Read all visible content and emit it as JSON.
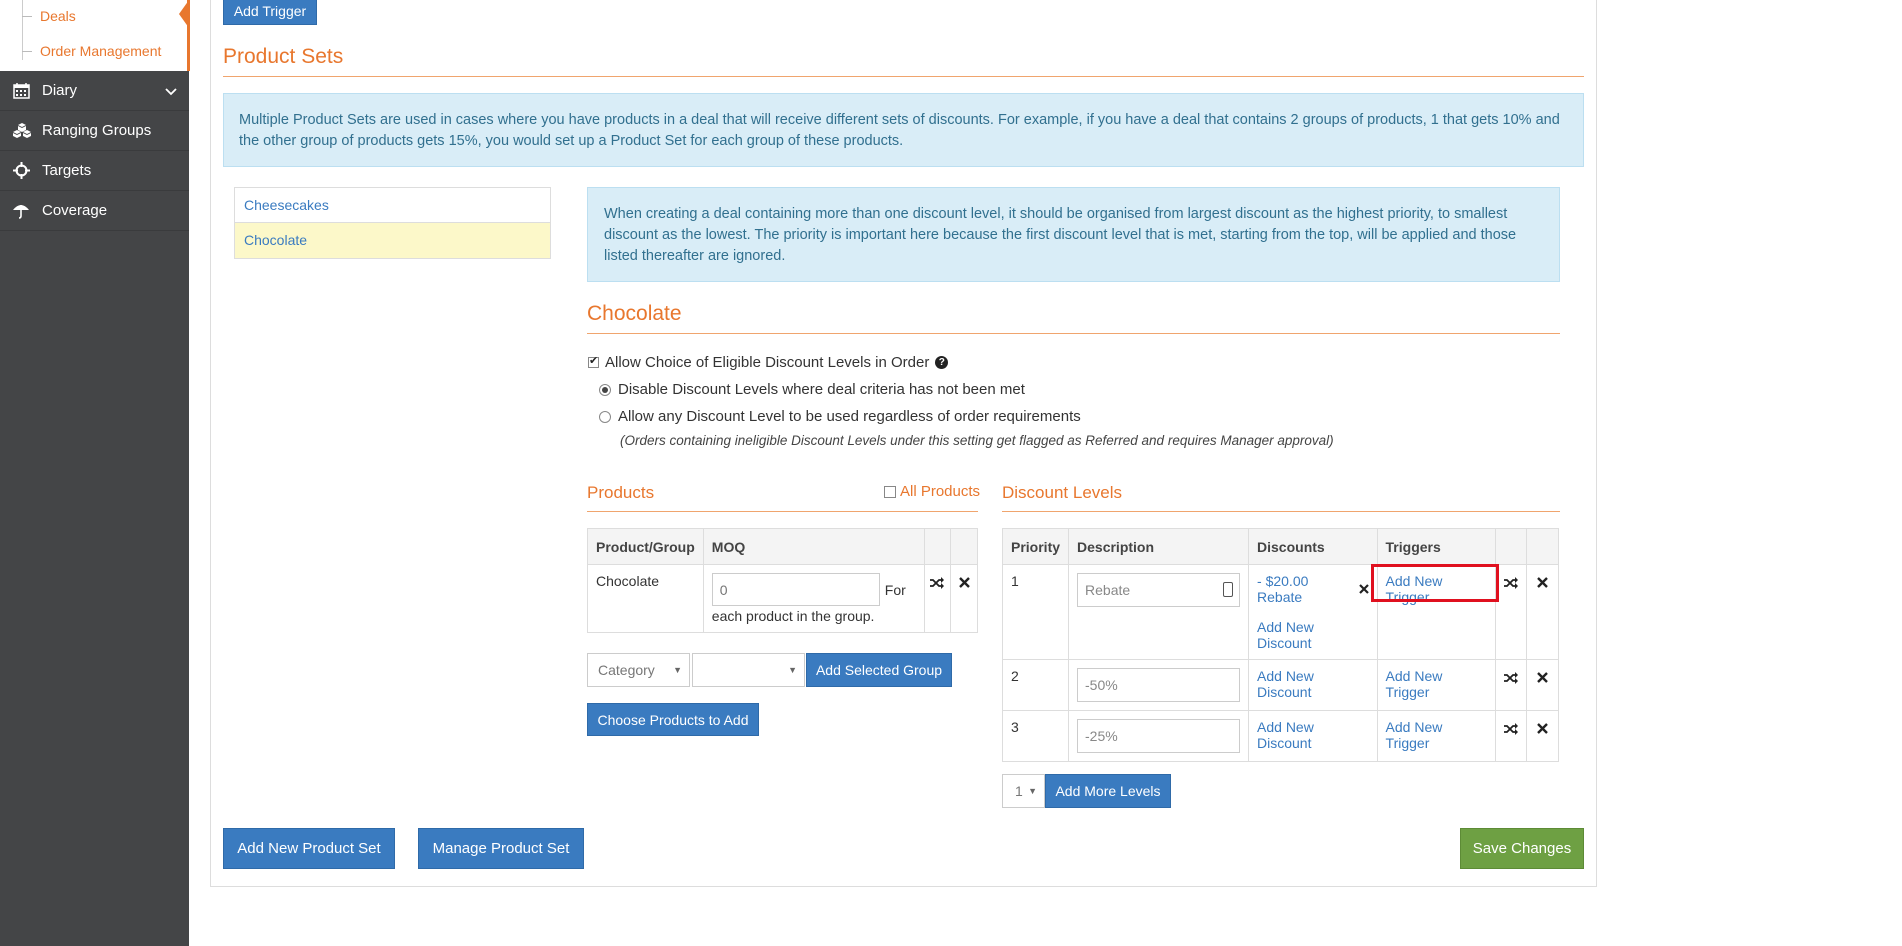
{
  "sidebar": {
    "sub_items": [
      {
        "label": "Deals"
      },
      {
        "label": "Order Management"
      }
    ],
    "nav": [
      {
        "label": "Diary",
        "icon": "calendar-icon",
        "has_chevron": true
      },
      {
        "label": "Ranging Groups",
        "icon": "cubes-icon"
      },
      {
        "label": "Targets",
        "icon": "crosshair-icon"
      },
      {
        "label": "Coverage",
        "icon": "umbrella-icon"
      }
    ]
  },
  "top": {
    "add_trigger_label": "Add Trigger"
  },
  "product_sets": {
    "title": "Product Sets",
    "info": "Multiple Product Sets are used in cases where you have products in a deal that will receive different sets of discounts. For example, if you have a deal that contains 2 groups of products, 1 that gets 10% and the other group of products gets 15%, you would set up a Product Set for each group of these products.",
    "list": [
      {
        "label": "Cheesecakes",
        "active": false
      },
      {
        "label": "Chocolate",
        "active": true
      }
    ]
  },
  "detail": {
    "info": "When creating a deal containing more than one discount level, it should be organised from largest discount as the highest priority, to smallest discount as the lowest. The priority is important here because the first discount level that is met, starting from the top, will be applied and those listed thereafter are ignored.",
    "title": "Chocolate",
    "allow_choice_label": "Allow Choice of Eligible Discount Levels in Order",
    "allow_choice_checked": true,
    "radio_disable_label": "Disable Discount Levels where deal criteria has not been met",
    "radio_allow_label": "Allow any Discount Level to be used regardless of order requirements",
    "radio_note": "(Orders containing ineligible Discount Levels under this setting get flagged as Referred and requires Manager approval)"
  },
  "products": {
    "title": "Products",
    "all_products_label": "All Products",
    "headers": [
      "Product/Group",
      "MOQ"
    ],
    "rows": [
      {
        "name": "Chocolate",
        "moq_placeholder": "0",
        "moq_suffix": "For",
        "moq_note": "each product in the group."
      }
    ],
    "category_select": "Category",
    "group_select": "",
    "add_group_label": "Add Selected Group",
    "choose_products_label": "Choose Products to Add"
  },
  "discount_levels": {
    "title": "Discount Levels",
    "headers": [
      "Priority",
      "Description",
      "Discounts",
      "Triggers"
    ],
    "rows": [
      {
        "priority": "1",
        "description_placeholder": "Rebate",
        "description_value": "",
        "discount": "- $20.00 Rebate",
        "add_discount": "Add New Discount",
        "trigger": "Add New Trigger"
      },
      {
        "priority": "2",
        "description_placeholder": "",
        "description_value": "-50%",
        "discount": "",
        "add_discount": "Add New Discount",
        "trigger": "Add New Trigger"
      },
      {
        "priority": "3",
        "description_placeholder": "",
        "description_value": "-25%",
        "discount": "",
        "add_discount": "Add New Discount",
        "trigger": "Add New Trigger"
      }
    ],
    "more_count": "1",
    "add_more_label": "Add More Levels"
  },
  "footer": {
    "add_set_label": "Add New Product Set",
    "manage_set_label": "Manage Product Set",
    "save_label": "Save Changes"
  },
  "colors": {
    "accent": "#e8772e",
    "primary": "#3a7bc0",
    "success": "#6ea043",
    "highlight": "#e0101f"
  }
}
